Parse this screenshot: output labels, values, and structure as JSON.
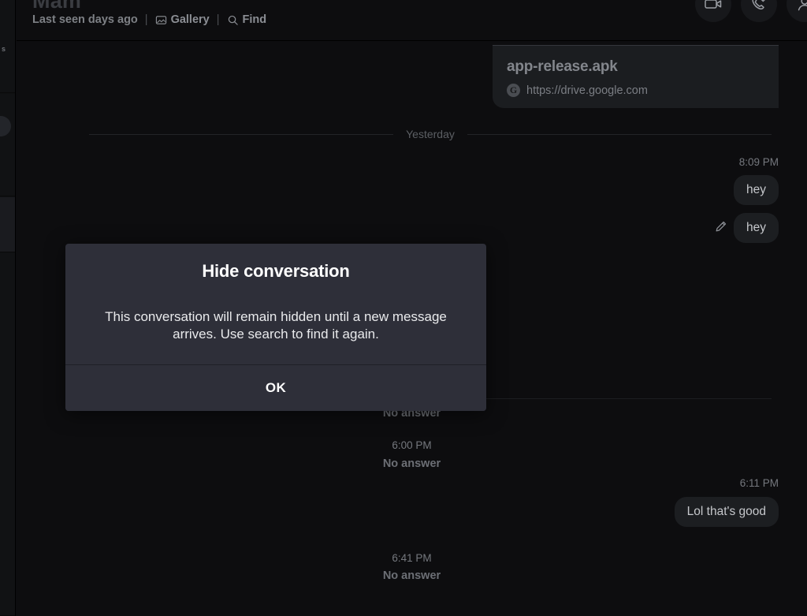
{
  "window": {
    "background": "#0d0d0f"
  },
  "sidebar": {
    "fragment_label": "s",
    "rows": [
      {
        "name": "conversation-row-1",
        "selected": false
      },
      {
        "name": "conversation-row-2",
        "selected": false
      },
      {
        "name": "conversation-row-3",
        "selected": true
      },
      {
        "name": "conversation-row-4",
        "selected": false
      }
    ]
  },
  "header": {
    "title": "Mam",
    "status": "Last seen days ago",
    "separator": "|",
    "gallery_label": "Gallery",
    "gallery_icon": "image-icon",
    "find_label": "Find",
    "find_icon": "search-icon",
    "actions": [
      {
        "name": "video-call-button",
        "icon": "video-camera-icon"
      },
      {
        "name": "voice-call-button",
        "icon": "phone-check-icon"
      },
      {
        "name": "contact-info-button",
        "icon": "person-icon"
      }
    ]
  },
  "conversation": {
    "link_card": {
      "title": "app-release.apk",
      "url": "https://drive.google.com",
      "favicon": "google-drive-icon",
      "favicon_letter": "G"
    },
    "date_divider": "Yesterday",
    "items": [
      {
        "kind": "timestamp",
        "text": "8:09 PM"
      },
      {
        "kind": "outgoing",
        "text": "hey",
        "edited": false
      },
      {
        "kind": "outgoing",
        "text": "hey",
        "edited": true,
        "edit_icon": "pencil-icon"
      },
      {
        "kind": "call",
        "text": "No answer"
      },
      {
        "kind": "timestamp",
        "text": "6:00 PM"
      },
      {
        "kind": "call",
        "text": "No answer"
      },
      {
        "kind": "timestamp",
        "text": "6:11 PM"
      },
      {
        "kind": "outgoing",
        "text": "Lol that's good",
        "edited": false
      },
      {
        "kind": "timestamp",
        "text": "6:41 PM"
      },
      {
        "kind": "call",
        "text": "No answer"
      }
    ]
  },
  "dialog": {
    "title": "Hide conversation",
    "message": "This conversation will remain hidden until a new message arrives. Use search to find it again.",
    "ok_label": "OK",
    "background": "#2e2f39"
  }
}
